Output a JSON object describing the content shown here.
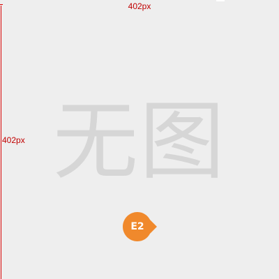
{
  "dimensions": {
    "width_label": "402px",
    "height_label": "402px"
  },
  "placeholder": {
    "text": "无图"
  },
  "marker": {
    "label": "E2",
    "color": "#f0892c"
  },
  "colors": {
    "background": "#eeeeee",
    "placeholder_text": "#d6d6d6",
    "dimension_lines": "#d80000"
  }
}
